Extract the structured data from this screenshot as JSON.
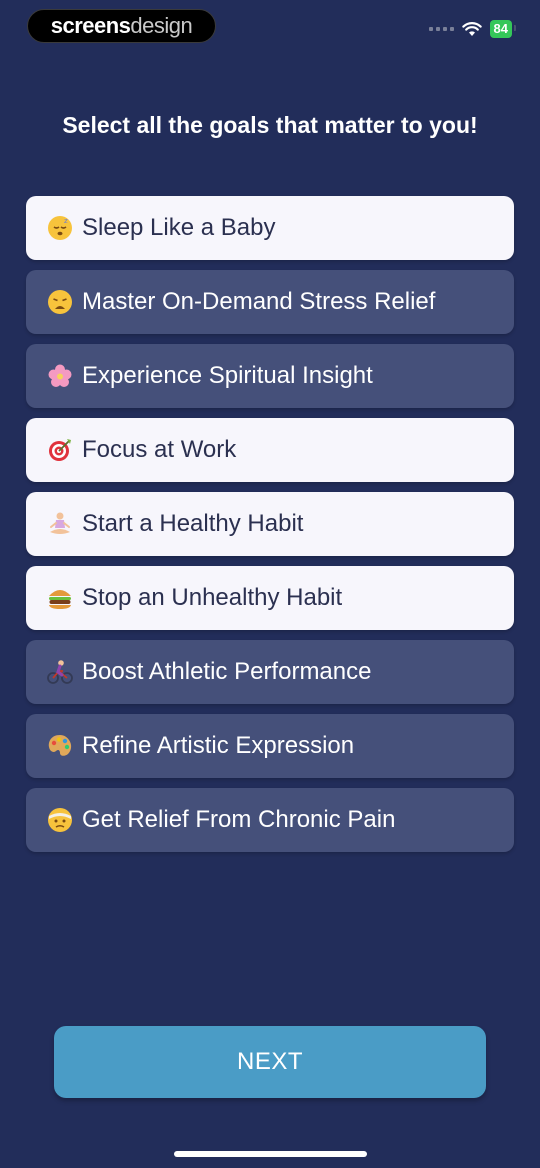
{
  "status_bar": {
    "brand_part1": "screens",
    "brand_part2": "design",
    "battery": "84"
  },
  "title": "Select all the goals that matter to you!",
  "goals": [
    {
      "label": "Sleep Like a Baby",
      "icon": "sleeping-face-icon",
      "selected": true
    },
    {
      "label": "Master On-Demand Stress Relief",
      "icon": "weary-face-icon",
      "selected": false
    },
    {
      "label": "Experience Spiritual Insight",
      "icon": "cherry-blossom-icon",
      "selected": false
    },
    {
      "label": "Focus at Work",
      "icon": "target-icon",
      "selected": true
    },
    {
      "label": "Start a Healthy Habit",
      "icon": "person-meditating-icon",
      "selected": true
    },
    {
      "label": "Stop an Unhealthy Habit",
      "icon": "hamburger-icon",
      "selected": true
    },
    {
      "label": "Boost Athletic Performance",
      "icon": "person-biking-icon",
      "selected": false
    },
    {
      "label": "Refine Artistic Expression",
      "icon": "artist-palette-icon",
      "selected": false
    },
    {
      "label": "Get Relief From Chronic Pain",
      "icon": "face-with-head-bandage-icon",
      "selected": false
    }
  ],
  "next_label": "NEXT",
  "colors": {
    "background": "#222d5a",
    "selected_bg": "#f7f6fc",
    "unselected_bg": "#45507a",
    "next_button": "#4a9cc6",
    "battery": "#34c759"
  }
}
